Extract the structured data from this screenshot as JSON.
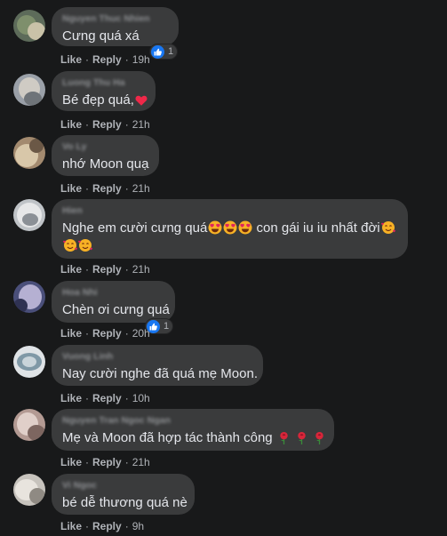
{
  "comments": [
    {
      "name": "Nguyen Thuc Nhien",
      "text": "Cưng quá xá",
      "like": "Like",
      "reply": "Reply",
      "time": "19h",
      "reactions": "1"
    },
    {
      "name": "Luong Thu Ha",
      "text": "Bé đẹp quá,",
      "like": "Like",
      "reply": "Reply",
      "time": "21h"
    },
    {
      "name": "Vo Ly",
      "text": "nhớ Moon quạ",
      "like": "Like",
      "reply": "Reply",
      "time": "21h"
    },
    {
      "name": "Hien",
      "text": "Nghe em cười cưng quá",
      "text_b": "con gái iu iu nhất đời",
      "like": "Like",
      "reply": "Reply",
      "time": "21h"
    },
    {
      "name": "Hoa Nhi",
      "text": "Chèn ơi cưng quá",
      "like": "Like",
      "reply": "Reply",
      "time": "20h",
      "reactions": "1"
    },
    {
      "name": "Vuong Linh",
      "text": "Nay cười nghe đã quá mẹ Moon.",
      "like": "Like",
      "reply": "Reply",
      "time": "10h"
    },
    {
      "name": "Nguyen Tran Ngoc Ngan",
      "text": "Mẹ và Moon đã hợp tác thành công",
      "like": "Like",
      "reply": "Reply",
      "time": "21h"
    },
    {
      "name": "Vi Ngoc",
      "text": "bé dễ thương quá nè",
      "like": "Like",
      "reply": "Reply",
      "time": "9h"
    }
  ],
  "icons": {
    "reaction": "like-thumb-icon",
    "heart": "red-heart-icon",
    "heart_eyes": "heart-eyes-emoji-icon",
    "smiling_hearts": "smiling-face-with-hearts-icon",
    "rose": "rose-emoji-icon"
  },
  "colors": {
    "background": "#18191a",
    "bubble": "#3a3b3c",
    "text": "#e4e6eb",
    "secondary": "#b0b3b8",
    "like_blue": "#1877f2"
  }
}
